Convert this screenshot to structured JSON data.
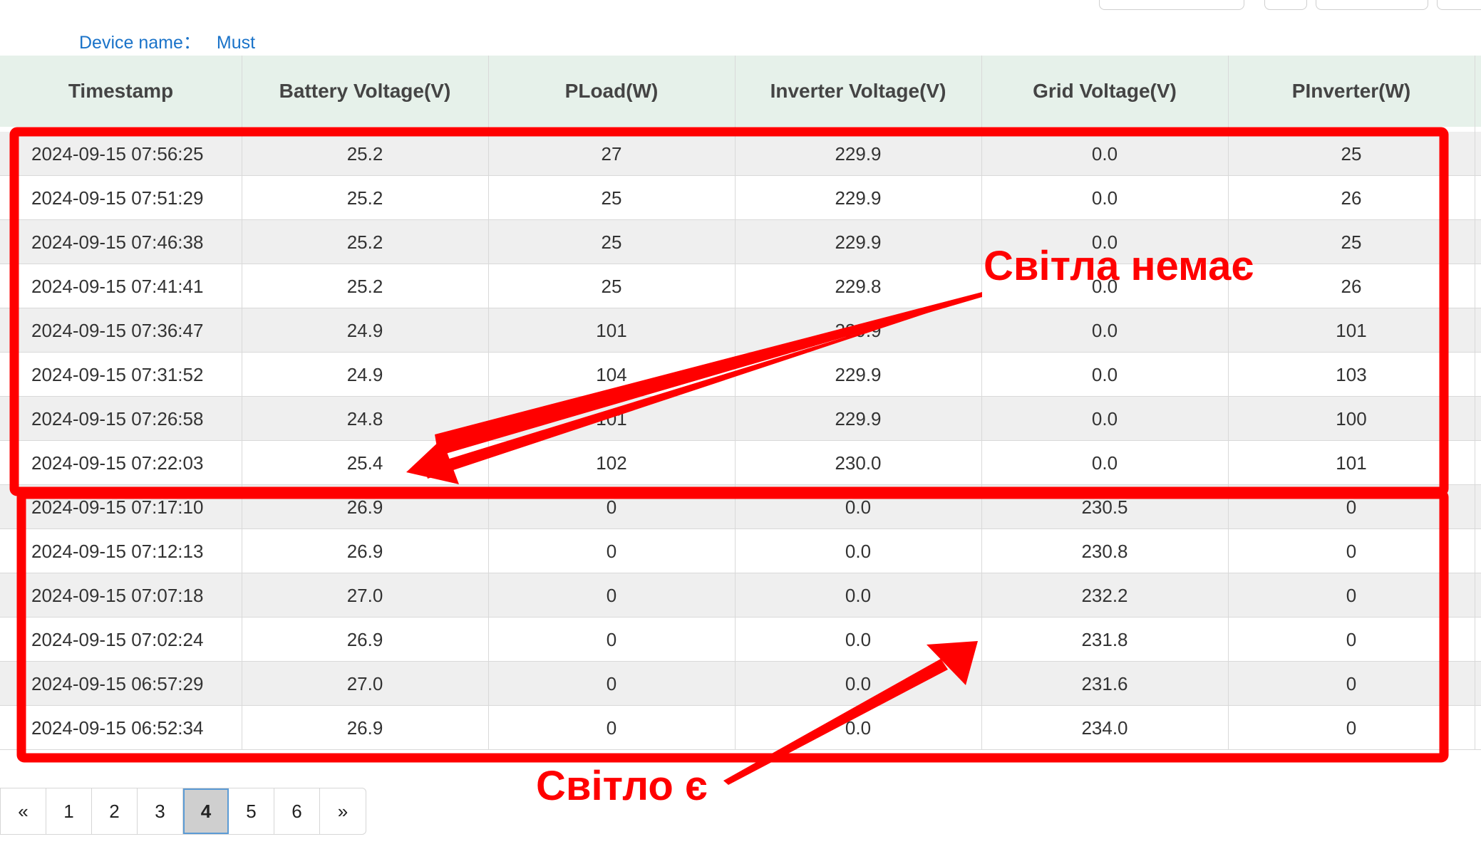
{
  "device": {
    "label": "Device name：",
    "value": "Must"
  },
  "table": {
    "columns": [
      "Timestamp",
      "Battery Voltage(V)",
      "PLoad(W)",
      "Inverter Voltage(V)",
      "Grid Voltage(V)",
      "PInverter(W)"
    ],
    "rows": [
      [
        "2024-09-15 07:56:25",
        "25.2",
        "27",
        "229.9",
        "0.0",
        "25"
      ],
      [
        "2024-09-15 07:51:29",
        "25.2",
        "25",
        "229.9",
        "0.0",
        "26"
      ],
      [
        "2024-09-15 07:46:38",
        "25.2",
        "25",
        "229.9",
        "0.0",
        "25"
      ],
      [
        "2024-09-15 07:41:41",
        "25.2",
        "25",
        "229.8",
        "0.0",
        "26"
      ],
      [
        "2024-09-15 07:36:47",
        "24.9",
        "101",
        "229.9",
        "0.0",
        "101"
      ],
      [
        "2024-09-15 07:31:52",
        "24.9",
        "104",
        "229.9",
        "0.0",
        "103"
      ],
      [
        "2024-09-15 07:26:58",
        "24.8",
        "101",
        "229.9",
        "0.0",
        "100"
      ],
      [
        "2024-09-15 07:22:03",
        "25.4",
        "102",
        "230.0",
        "0.0",
        "101"
      ],
      [
        "2024-09-15 07:17:10",
        "26.9",
        "0",
        "0.0",
        "230.5",
        "0"
      ],
      [
        "2024-09-15 07:12:13",
        "26.9",
        "0",
        "0.0",
        "230.8",
        "0"
      ],
      [
        "2024-09-15 07:07:18",
        "27.0",
        "0",
        "0.0",
        "232.2",
        "0"
      ],
      [
        "2024-09-15 07:02:24",
        "26.9",
        "0",
        "0.0",
        "231.8",
        "0"
      ],
      [
        "2024-09-15 06:57:29",
        "27.0",
        "0",
        "0.0",
        "231.6",
        "0"
      ],
      [
        "2024-09-15 06:52:34",
        "26.9",
        "0",
        "0.0",
        "234.0",
        "0"
      ]
    ]
  },
  "pagination": {
    "prev": "«",
    "pages": [
      "1",
      "2",
      "3",
      "4",
      "5",
      "6"
    ],
    "current": "4",
    "next": "»"
  },
  "annotations": {
    "no_power": "Світла немає",
    "power_on": "Світло є",
    "color": "#ff0000"
  },
  "colors": {
    "header_bg": "#e6f1ea",
    "link": "#1a73c9",
    "row_alt": "#efefef"
  }
}
